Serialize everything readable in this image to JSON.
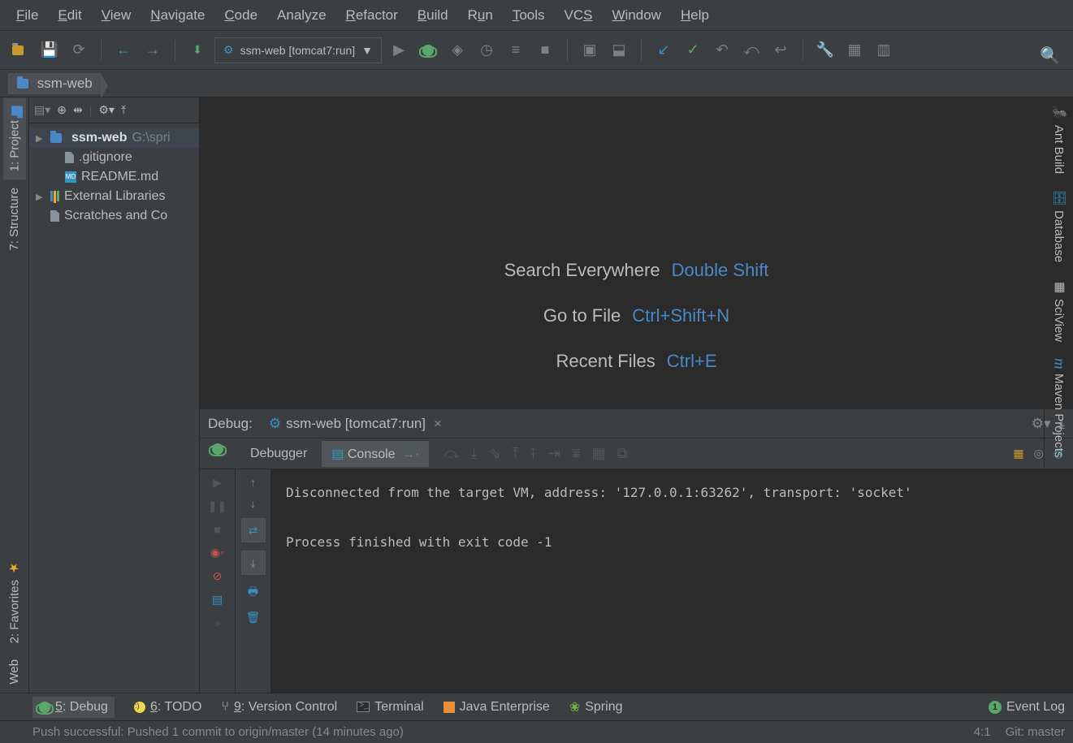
{
  "menu": {
    "file": "File",
    "edit": "Edit",
    "view": "View",
    "navigate": "Navigate",
    "code": "Code",
    "analyze": "Analyze",
    "refactor": "Refactor",
    "build": "Build",
    "run": "Run",
    "tools": "Tools",
    "vcs": "VCS",
    "window": "Window",
    "help": "Help"
  },
  "toolbar": {
    "run_config_label": "ssm-web [tomcat7:run]"
  },
  "breadcrumb": {
    "root": "ssm-web"
  },
  "left_tabs": {
    "project": "1: Project",
    "structure": "7: Structure",
    "favorites": "2: Favorites",
    "web": "Web"
  },
  "right_tabs": {
    "ant": "Ant Build",
    "database": "Database",
    "sciview": "SciView",
    "maven": "Maven Projects"
  },
  "project_tree": {
    "root_name": "ssm-web",
    "root_path": "G:\\spri",
    "gitignore": ".gitignore",
    "readme": "README.md",
    "ext_lib": "External Libraries",
    "scratches": "Scratches and Co"
  },
  "editor_hints": {
    "search_label": "Search Everywhere",
    "search_key": "Double Shift",
    "goto_label": "Go to File",
    "goto_key": "Ctrl+Shift+N",
    "recent_label": "Recent Files",
    "recent_key": "Ctrl+E"
  },
  "debug": {
    "title": "Debug:",
    "tab_label": "ssm-web [tomcat7:run]",
    "debugger_tab": "Debugger",
    "console_tab": "Console",
    "console_text": "Disconnected from the target VM, address: '127.0.0.1:63262', transport: 'socket'\n\nProcess finished with exit code -1"
  },
  "bottom": {
    "debug": "5: Debug",
    "todo": "6: TODO",
    "vcs": "9: Version Control",
    "terminal": "Terminal",
    "java_ee": "Java Enterprise",
    "spring": "Spring",
    "event_log": "Event Log",
    "event_count": "1"
  },
  "status": {
    "msg": "Push successful: Pushed 1 commit to origin/master (14 minutes ago)",
    "pos": "4:1",
    "git": "Git: master"
  }
}
